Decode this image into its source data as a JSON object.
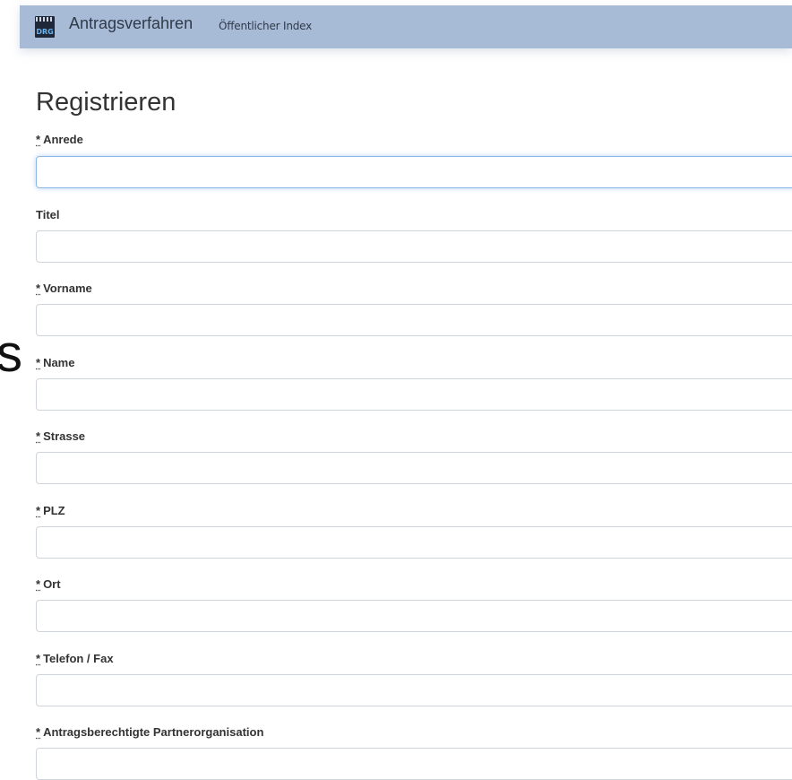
{
  "navbar": {
    "logo_text": "DRG",
    "brand": "Antragsverfahren",
    "link": "Öffentlicher Index"
  },
  "side_char": "s",
  "page": {
    "title": "Registrieren"
  },
  "required_marker": "*",
  "form": {
    "fields": [
      {
        "label": "Anrede",
        "required": true,
        "value": ""
      },
      {
        "label": "Titel",
        "required": false,
        "value": ""
      },
      {
        "label": "Vorname",
        "required": true,
        "value": ""
      },
      {
        "label": "Name",
        "required": true,
        "value": ""
      },
      {
        "label": "Strasse",
        "required": true,
        "value": ""
      },
      {
        "label": "PLZ",
        "required": true,
        "value": ""
      },
      {
        "label": "Ort",
        "required": true,
        "value": ""
      },
      {
        "label": "Telefon / Fax",
        "required": true,
        "value": ""
      },
      {
        "label": "Antragsberechtigte Partnerorganisation",
        "required": true,
        "value": ""
      }
    ]
  }
}
